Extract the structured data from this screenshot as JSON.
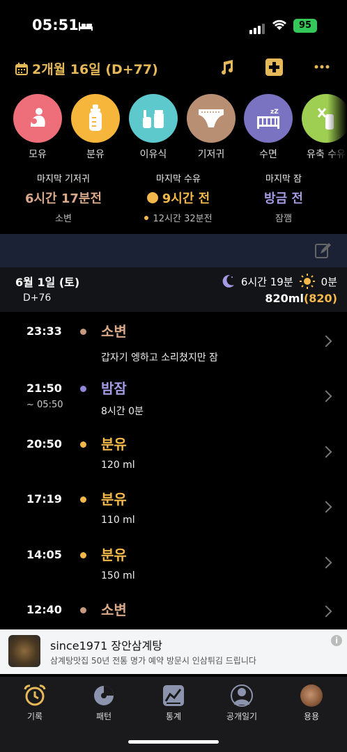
{
  "status": {
    "time": "05:51",
    "battery": "95"
  },
  "header": {
    "date": "2개월 16일 (D+77)",
    "icons": [
      "calendar-icon",
      "music-icon",
      "add-icon",
      "more-icon"
    ]
  },
  "categories": [
    {
      "label": "모유",
      "color": "#ee6f7a",
      "icon": "breastfeeding-icon"
    },
    {
      "label": "분유",
      "color": "#f6b63c",
      "icon": "bottle-icon"
    },
    {
      "label": "이유식",
      "color": "#5ec9cd",
      "icon": "baby-food-icon"
    },
    {
      "label": "기저귀",
      "color": "#b98f74",
      "icon": "diaper-icon"
    },
    {
      "label": "수면",
      "color": "#7a73c2",
      "icon": "sleep-icon"
    },
    {
      "label": "유축 수유",
      "color": "#9fcf52",
      "icon": "pumped-milk-icon"
    }
  ],
  "last": {
    "diaper": {
      "title": "마지막 기저귀",
      "value": "6시간 17분전",
      "sub": "소변",
      "color": "#d9a98a"
    },
    "feed": {
      "title": "마지막 수유",
      "value": "9시간 전",
      "sub": "12시간 32분전",
      "color": "#f2b84b"
    },
    "sleep": {
      "title": "마지막 잠",
      "value": "방금 전",
      "sub": "잠깸",
      "color": "#a39be3"
    }
  },
  "day": {
    "date": "6월 1일 (토)",
    "dday": "D+76",
    "night_sleep": "6시간 19분",
    "day_sleep": "0분",
    "ml": "820ml",
    "ml_paren": "820"
  },
  "timeline": [
    {
      "time": "23:33",
      "end": "",
      "title": "소변",
      "sub": "갑자기 엥하고 소리쳤지만 잠",
      "color": "#c79a7f"
    },
    {
      "time": "21:50",
      "end": "~ 05:50",
      "title": "밤잠",
      "sub": "8시간 0분",
      "color": "#8f86d9"
    },
    {
      "time": "20:50",
      "end": "",
      "title": "분유",
      "sub": "120 ml",
      "color": "#f2b84b"
    },
    {
      "time": "17:19",
      "end": "",
      "title": "분유",
      "sub": "110 ml",
      "color": "#f2b84b"
    },
    {
      "time": "14:05",
      "end": "",
      "title": "분유",
      "sub": "150 ml",
      "color": "#f2b84b"
    },
    {
      "time": "12:40",
      "end": "",
      "title": "소변",
      "sub": "",
      "color": "#c79a7f"
    }
  ],
  "ad": {
    "title": "since1971 장안삼계탕",
    "sub": "삼계탕맛집 50년 전통 명가 예약 방문시 인삼튀김 드립니다",
    "info": "i"
  },
  "tabs": [
    {
      "label": "기록",
      "icon": "alarm-clock-icon"
    },
    {
      "label": "패턴",
      "icon": "pattern-icon"
    },
    {
      "label": "통계",
      "icon": "chart-icon"
    },
    {
      "label": "공개일기",
      "icon": "community-icon"
    },
    {
      "label": "용용",
      "icon": "profile-avatar-icon"
    }
  ]
}
